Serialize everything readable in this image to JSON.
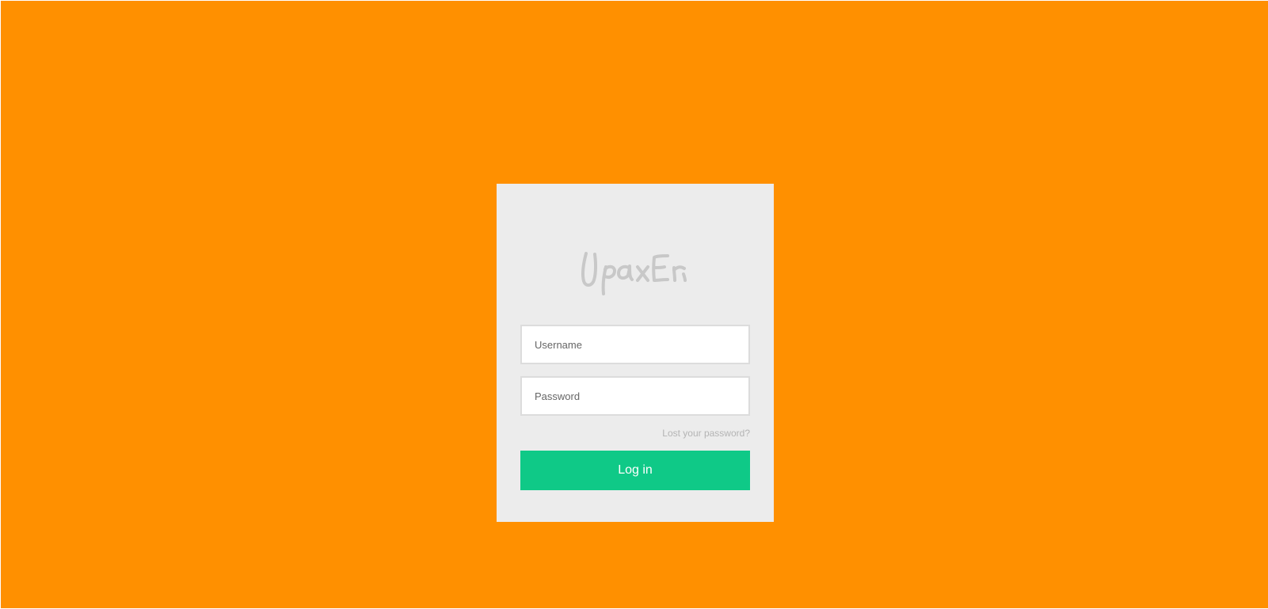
{
  "brand": {
    "logo_text": "UpaxEr"
  },
  "login_form": {
    "username": {
      "value": "",
      "placeholder": "Username"
    },
    "password": {
      "value": "",
      "placeholder": "Password"
    },
    "lost_password_label": "Lost your password?",
    "submit_label": "Log in"
  },
  "colors": {
    "page_background": "#ff9000",
    "card_background": "#ececec",
    "button_background": "#0fc987",
    "logo_color": "#c8c8c8"
  }
}
